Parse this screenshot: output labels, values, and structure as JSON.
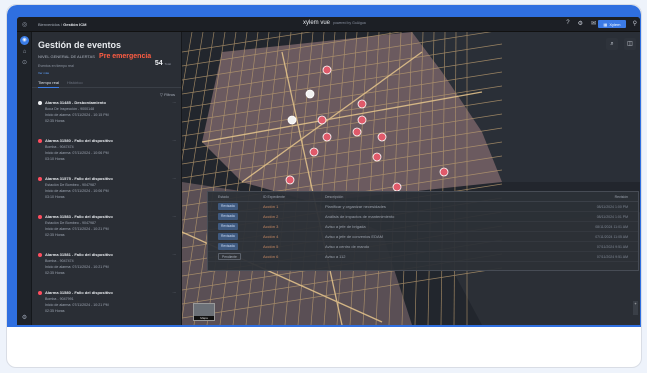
{
  "topbar": {
    "breadcrumb_prefix": "Bienvenidos",
    "breadcrumb_current": "Gestión ICM",
    "brand": "xylem vue",
    "brand_sub": "powered by GoAigua",
    "user_button": "Xylem",
    "icons": [
      "help-icon",
      "settings-icon",
      "mail-icon",
      "user-icon"
    ]
  },
  "panel": {
    "title": "Gestión de eventos",
    "alert_label": "NIVEL GENERAL DE ALERTAS",
    "alert_level": "Pre emergencia",
    "alert_color": "#ff5d43",
    "sub_label": "Eventos en tiempo real",
    "count": "54",
    "count_unit": "Total",
    "small_link": "Ver más",
    "tab_realtime": "Tiempo real",
    "tab_history": "Histórico",
    "filter_label": "Filtros",
    "events": [
      {
        "title": "Alarma 31485 - Desbordamiento",
        "l1": "Boca De Inspección - 9000148",
        "l2": "Inicio de alarma: 07/11/2024 - 10:15 PM",
        "l3": "02:35 Horas",
        "dot": "white"
      },
      {
        "title": "Alarma 31580 - Fallo del dispositivo",
        "l1": "Bomba - 9047474",
        "l2": "Inicio de alarma: 07/11/2024 - 10:06 PM",
        "l3": "03:10 Horas",
        "dot": "red"
      },
      {
        "title": "Alarma 31575 - Fallo del dispositivo",
        "l1": "Estación De Bombeo - 9047987",
        "l2": "Inicio de alarma: 07/11/2024 - 10:06 PM",
        "l3": "03:10 Horas",
        "dot": "red"
      },
      {
        "title": "Alarma 31583 - Fallo del dispositivo",
        "l1": "Estación De Bombeo - 9047987",
        "l2": "Inicio de alarma: 07/11/2024 - 10:21 PM",
        "l3": "02:35 Horas",
        "dot": "red"
      },
      {
        "title": "Alarma 31581 - Fallo del dispositivo",
        "l1": "Bomba - 9047474",
        "l2": "Inicio de alarma: 07/11/2024 - 10:21 PM",
        "l3": "02:35 Horas",
        "dot": "red"
      },
      {
        "title": "Alarma 31580 - Fallo del dispositivo",
        "l1": "Bomba - 9047991",
        "l2": "Inicio de alarma: 07/11/2024 - 10:21 PM",
        "l3": "02:35 Horas",
        "dot": "red"
      }
    ]
  },
  "table": {
    "headers": [
      "Estado",
      "ID Expediente",
      "Descripción",
      "Revisión"
    ],
    "rows": [
      {
        "status": "Revisada",
        "id": "Acción 1",
        "desc": "Planificar y organizar necesidades",
        "date": "08/11/2024 1:00 PM"
      },
      {
        "status": "Revisada",
        "id": "Acción 2",
        "desc": "Análisis de impactos de mantenimiento",
        "date": "08/11/2024 1:01 PM"
      },
      {
        "status": "Revisada",
        "id": "Acción 3",
        "desc": "Aviso a jefe de brigada",
        "date": "08/11/2024 11:01 AM"
      },
      {
        "status": "Revisada",
        "id": "Acción 4",
        "desc": "Aviso a jefe de convenios EDAM",
        "date": "07/11/2024 11:05 AM"
      },
      {
        "status": "Revisada",
        "id": "Acción 5",
        "desc": "Aviso a centro de mando",
        "date": "07/11/2024 9:51 AM"
      },
      {
        "status": "Pendiente",
        "id": "Acción 6",
        "desc": "Aviso a 112",
        "date": "07/11/2024 9:51 AM"
      }
    ]
  },
  "map": {
    "minimap_label": "Mapa"
  }
}
